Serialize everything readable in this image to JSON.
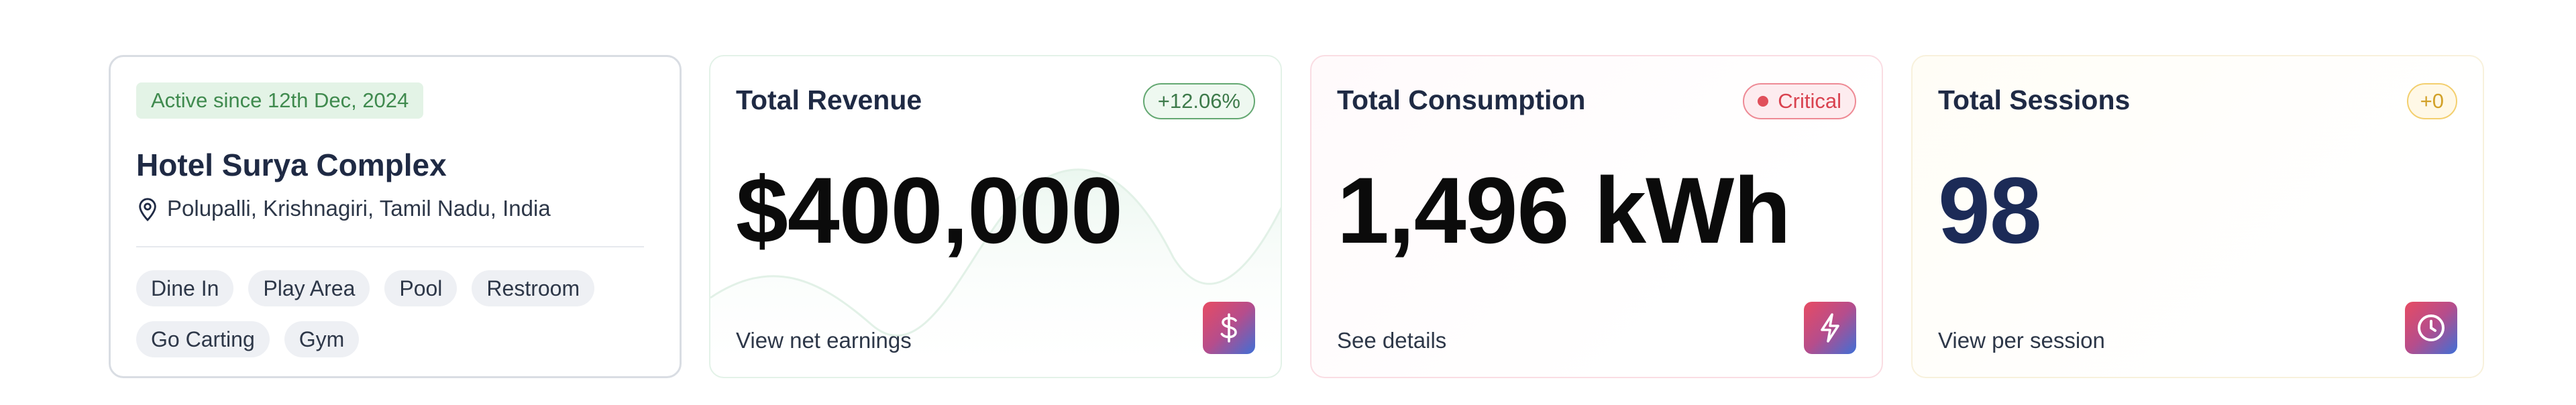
{
  "property": {
    "since_badge": "Active since 12th Dec, 2024",
    "name": "Hotel Surya Complex",
    "location_icon": "map-pin-icon",
    "location": "Polupalli, Krishnagiri, Tamil Nadu, India",
    "amenities_row1": [
      "Dine In",
      "Play Area",
      "Pool",
      "Restroom"
    ],
    "amenities_row2": [
      "Go Carting",
      "Gym"
    ]
  },
  "revenue": {
    "title": "Total Revenue",
    "change": "+12.06%",
    "value": "$400,000",
    "link": "View net earnings",
    "icon": "dollar-icon"
  },
  "consumption": {
    "title": "Total Consumption",
    "status": "Critical",
    "value": "1,496 kWh",
    "link": "See details",
    "icon": "lightning-icon"
  },
  "sessions": {
    "title": "Total Sessions",
    "change": "+0",
    "value": "98",
    "link": "View per session",
    "icon": "clock-icon"
  },
  "colors": {
    "green_accent": "#3f8a4e",
    "critical_red": "#d9424f",
    "amber": "#d2a129",
    "navy": "#1c2b57",
    "icon_gradient_start": "#e74c63",
    "icon_gradient_end": "#3f6fd6"
  }
}
